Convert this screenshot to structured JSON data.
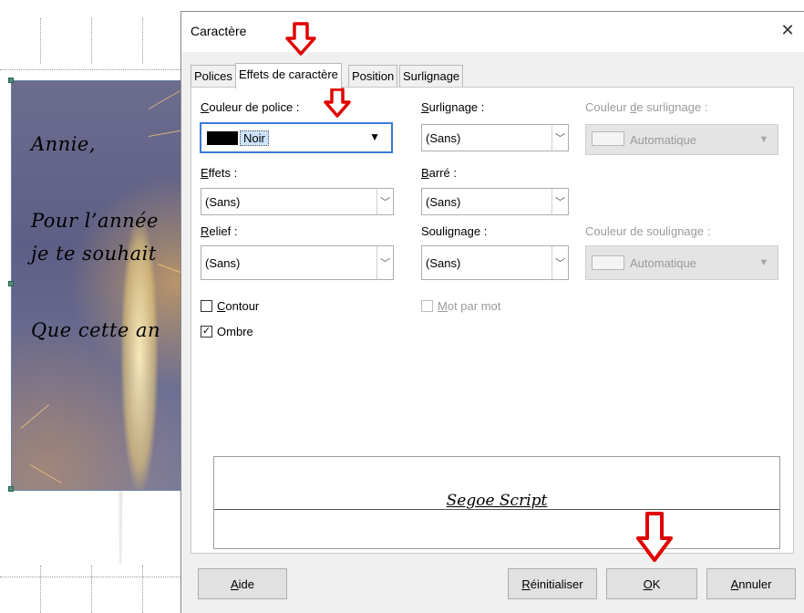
{
  "background_document": {
    "card_lines": [
      "Annie,",
      "Pour l’année",
      "je te souhait",
      "Que cette an"
    ]
  },
  "dialog": {
    "title": "Caractère",
    "close_symbol": "✕",
    "tabs": [
      {
        "label": "Polices",
        "active": false
      },
      {
        "label": "Effets de caractère",
        "active": true
      },
      {
        "label": "Position",
        "active": false
      },
      {
        "label": "Surlignage",
        "active": false
      }
    ],
    "font_color": {
      "label_underlined": "C",
      "label_rest": "ouleur de police :",
      "swatch_color": "#000000",
      "value": "Noir",
      "arrow": "▼"
    },
    "highlighting": {
      "label_underlined": "S",
      "label_rest": "urlignage :",
      "value": "(Sans)"
    },
    "highlight_color": {
      "label_pre": "Couleur ",
      "label_underlined": "d",
      "label_rest": "e surlignage :",
      "value": "Automatique"
    },
    "effects": {
      "label_underlined": "E",
      "label_rest": "ffets :",
      "value": "(Sans)"
    },
    "strikethrough": {
      "label_underlined": "B",
      "label_rest": "arré :",
      "value": "(Sans)"
    },
    "relief": {
      "label_underlined": "R",
      "label_rest": "elief :",
      "value": "(Sans)"
    },
    "underlining": {
      "label_pre": "Souli",
      "label_underlined": "g",
      "label_rest": "nage :",
      "value": "(Sans)"
    },
    "underline_color": {
      "label_pre": "Couleur de souli",
      "label_underlined": "g",
      "label_rest": "nage :",
      "value": "Automatique"
    },
    "outline": {
      "label_underlined": "C",
      "label_rest": "ontour",
      "checked": false
    },
    "shadow": {
      "label": "Ombre",
      "checked": true,
      "mark": "✓"
    },
    "word_by_word": {
      "label_underlined": "M",
      "label_rest": "ot par mot",
      "checked": false
    },
    "preview_text": "Segoe Script",
    "buttons": {
      "help_underlined": "A",
      "help_rest": "ide",
      "reset_underlined": "R",
      "reset_rest": "éinitialiser",
      "ok_underlined": "O",
      "ok_rest": "K",
      "cancel_underlined": "A",
      "cancel_rest": "nnuler"
    }
  },
  "colors": {
    "annotation_arrow": "#e00000",
    "focus_border": "#3a7bd5"
  }
}
